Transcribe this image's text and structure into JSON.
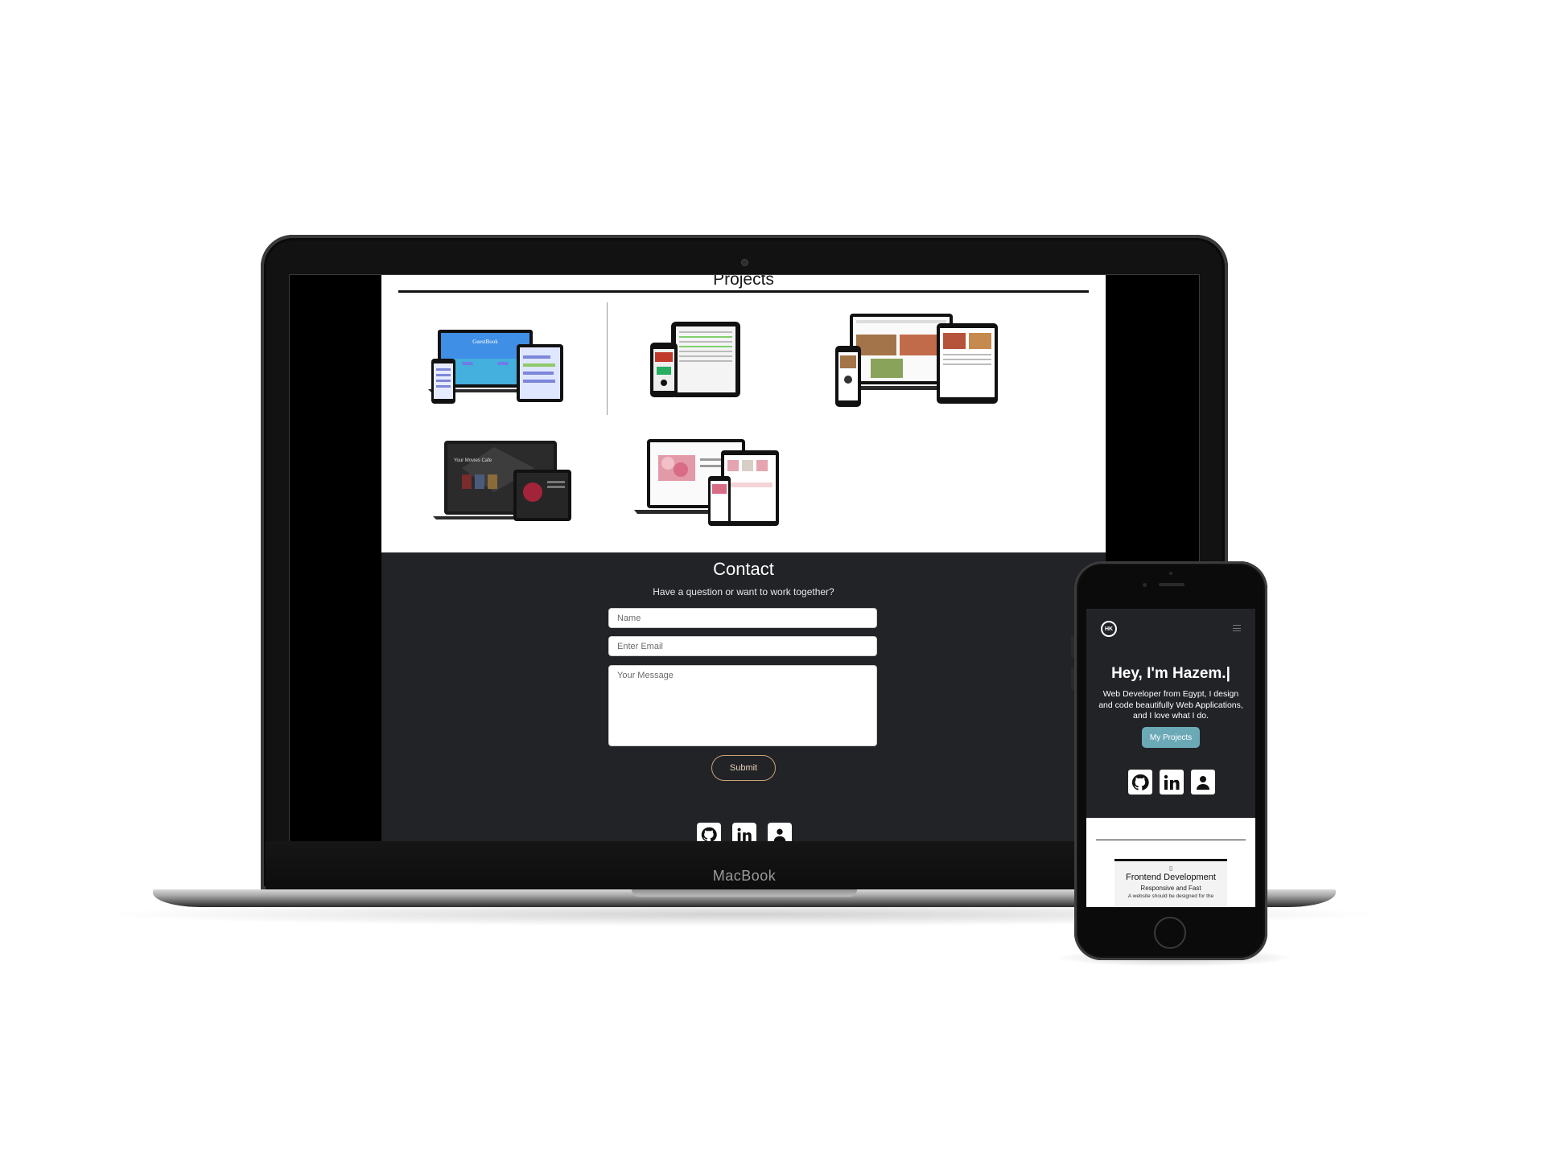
{
  "laptop": {
    "brand_label": "MacBook",
    "projects": {
      "title": "Projects",
      "thumbnails": [
        {
          "name": "guestbook-mockup",
          "caption": "GuestBook"
        },
        {
          "name": "tablet-phone-app-mockup"
        },
        {
          "name": "restaurant-site-mockup"
        },
        {
          "name": "movies-site-mockup",
          "caption": "Your Movies Cafe"
        },
        {
          "name": "flower-shop-mockup"
        }
      ]
    },
    "contact": {
      "title": "Contact",
      "subtitle": "Have a question or want to work together?",
      "name_placeholder": "Name",
      "email_placeholder": "Enter Email",
      "message_placeholder": "Your Message",
      "submit_label": "Submit"
    },
    "social_icons": [
      "github-icon",
      "linkedin-icon",
      "user-contact-icon"
    ]
  },
  "phone": {
    "logo_text": "HK",
    "hero": {
      "title": "Hey, I'm Hazem.|",
      "text": "Web Developer from Egypt, I design and code beautifully Web Applications, and I love what I do.",
      "button_label": "My Projects"
    },
    "social_icons": [
      "github-icon",
      "linkedin-icon",
      "user-contact-icon"
    ],
    "card": {
      "icon": "▯",
      "title": "Frontend Development",
      "subtitle": "Responsive and Fast",
      "text": "A website should be designed for the"
    }
  },
  "colors": {
    "dark_bg": "#222327",
    "accent_button": "#6ba9b7",
    "submit_border": "#c9a27a"
  }
}
